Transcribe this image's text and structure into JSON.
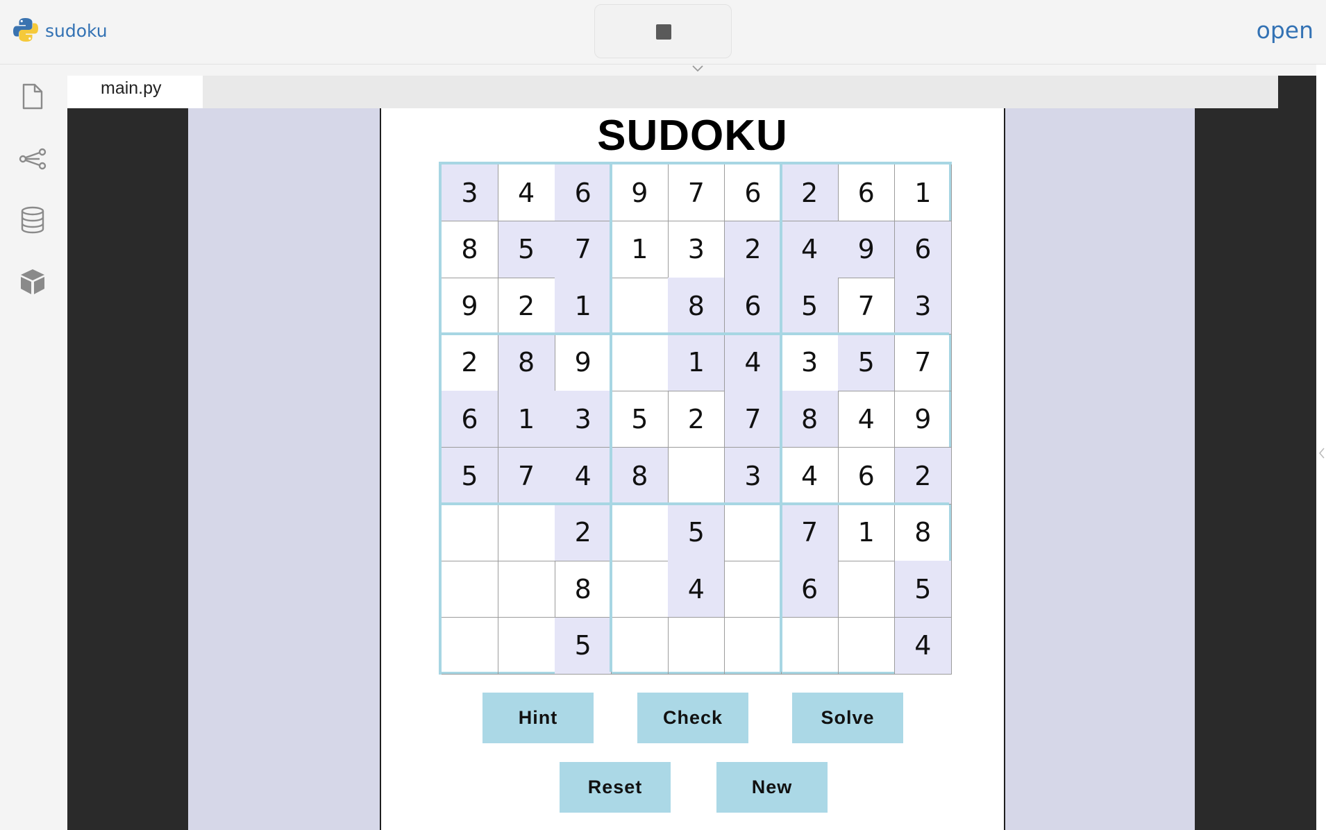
{
  "app": {
    "name": "sudoku",
    "open_label": "open"
  },
  "toolbar": {
    "stop_icon": "stop-icon",
    "collapse_icon": "chevron-down-icon"
  },
  "siderail": {
    "items": [
      {
        "name": "file-icon"
      },
      {
        "name": "share-icon"
      },
      {
        "name": "database-icon"
      },
      {
        "name": "package-icon"
      }
    ]
  },
  "tabs": [
    {
      "label": "main.py",
      "active": true
    }
  ],
  "game": {
    "title": "SUDOKU",
    "grid": [
      [
        "3",
        "4",
        "6",
        "9",
        "7",
        "6",
        "2",
        "6",
        "1"
      ],
      [
        "8",
        "5",
        "7",
        "1",
        "3",
        "2",
        "4",
        "9",
        "6"
      ],
      [
        "9",
        "2",
        "1",
        "",
        "8",
        "6",
        "5",
        "7",
        "3"
      ],
      [
        "2",
        "8",
        "9",
        "",
        "1",
        "4",
        "3",
        "5",
        "7"
      ],
      [
        "6",
        "1",
        "3",
        "5",
        "2",
        "7",
        "8",
        "4",
        "9"
      ],
      [
        "5",
        "7",
        "4",
        "8",
        "",
        "3",
        "4",
        "6",
        "2"
      ],
      [
        "",
        "",
        "2",
        "",
        "5",
        "",
        "7",
        "1",
        "8"
      ],
      [
        "",
        "",
        "8",
        "",
        "4",
        "",
        "6",
        "",
        "5"
      ],
      [
        "",
        "",
        "5",
        "",
        "",
        "",
        "",
        "",
        "4"
      ]
    ],
    "shaded": [
      [
        1,
        0,
        1,
        0,
        0,
        0,
        1,
        0,
        0
      ],
      [
        0,
        1,
        1,
        0,
        0,
        1,
        1,
        1,
        1
      ],
      [
        0,
        0,
        1,
        0,
        1,
        1,
        1,
        0,
        1
      ],
      [
        0,
        1,
        0,
        0,
        1,
        1,
        0,
        1,
        0
      ],
      [
        1,
        1,
        1,
        0,
        0,
        1,
        1,
        0,
        0
      ],
      [
        1,
        1,
        1,
        1,
        0,
        1,
        0,
        0,
        1
      ],
      [
        0,
        0,
        1,
        0,
        1,
        0,
        1,
        0,
        0
      ],
      [
        0,
        0,
        0,
        0,
        1,
        0,
        1,
        0,
        1
      ],
      [
        0,
        0,
        1,
        0,
        0,
        0,
        0,
        0,
        1
      ]
    ],
    "buttons": {
      "hint": "Hint",
      "check": "Check",
      "solve": "Solve",
      "reset": "Reset",
      "new": "New"
    }
  },
  "colors": {
    "accent": "#3372b4",
    "cell_shaded": "#e5e5f7",
    "grid_border": "#a7d6e3",
    "button_bg": "#abd8e6",
    "canvas_bg": "#d6d7e8"
  }
}
